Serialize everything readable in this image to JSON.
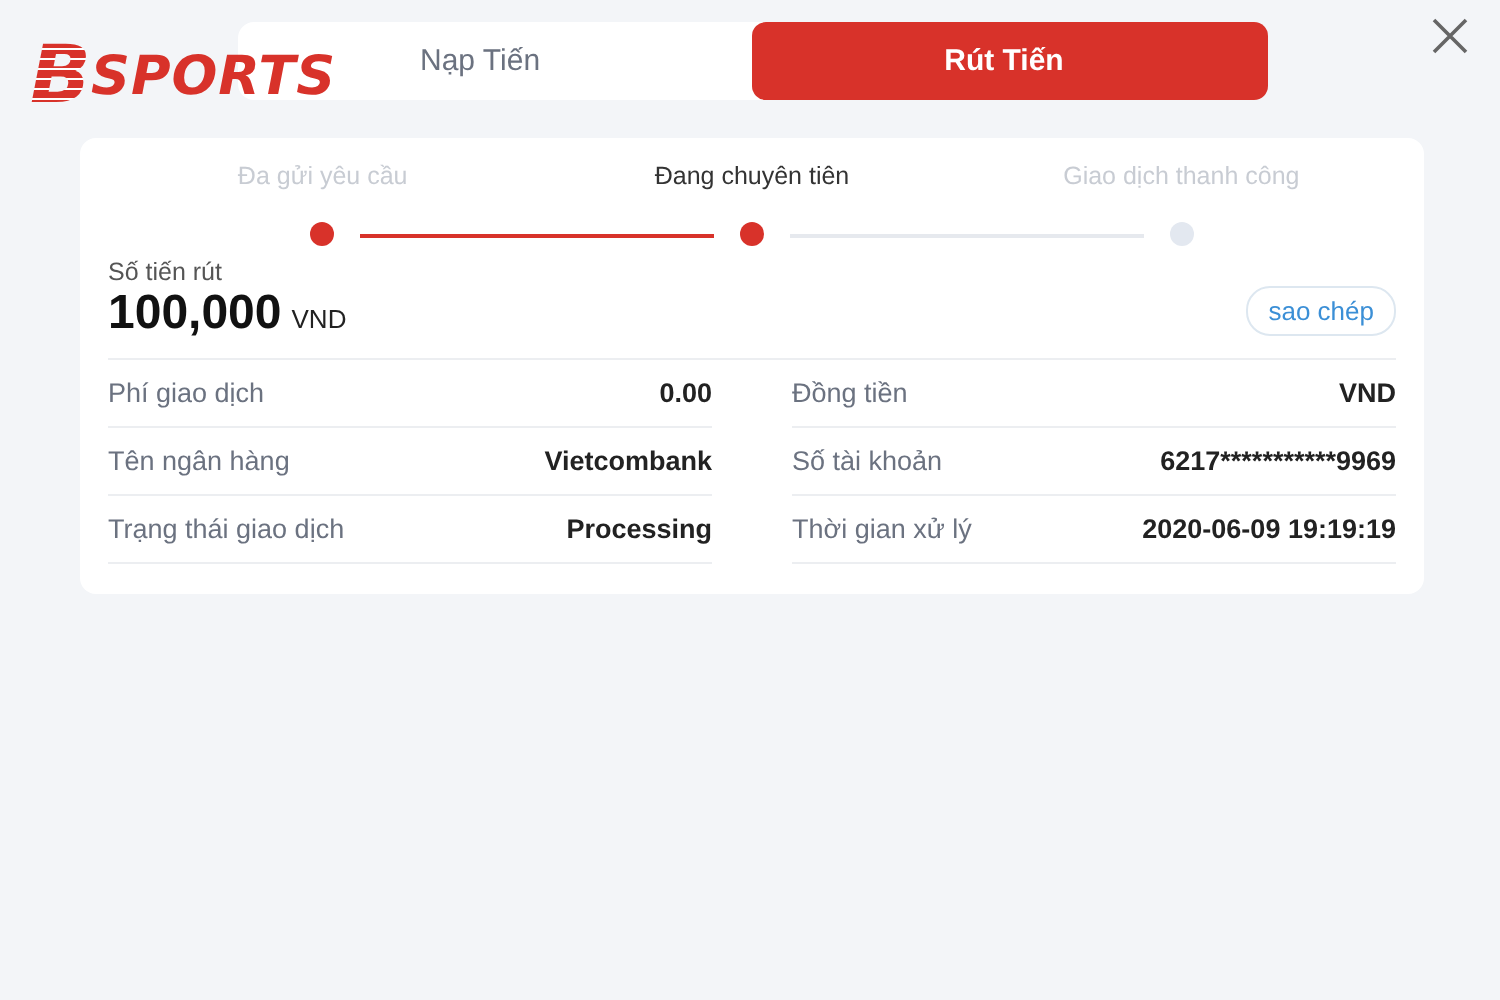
{
  "logo": {
    "mark": "B",
    "text": "SPORTS"
  },
  "tabs": [
    {
      "label": "Nạp Tiến",
      "selected": false
    },
    {
      "label": "Rút Tiến",
      "selected": true
    }
  ],
  "steps": [
    {
      "label": "Đa gửi yêu cầu",
      "completed": true,
      "current": false
    },
    {
      "label": "Đang chuyên tiên",
      "completed": false,
      "current": true
    },
    {
      "label": "Giao dịch thanh công",
      "completed": false,
      "current": false
    }
  ],
  "amount": {
    "label": "Số tiến rút",
    "value": "100,000",
    "currency": "VND"
  },
  "copy_button": "sao chép",
  "details": [
    {
      "label": "Phí giao dịch",
      "value": "0.00"
    },
    {
      "label": "Đồng tiền",
      "value": "VND"
    },
    {
      "label": "Tên ngân hàng",
      "value": "Vietcombank"
    },
    {
      "label": "Số tài khoản",
      "value": "6217***********9969"
    },
    {
      "label": "Trạng thái giao dịch",
      "value": "Processing"
    },
    {
      "label": "Thời gian xử lý",
      "value": "2020-06-09 19:19:19"
    }
  ]
}
